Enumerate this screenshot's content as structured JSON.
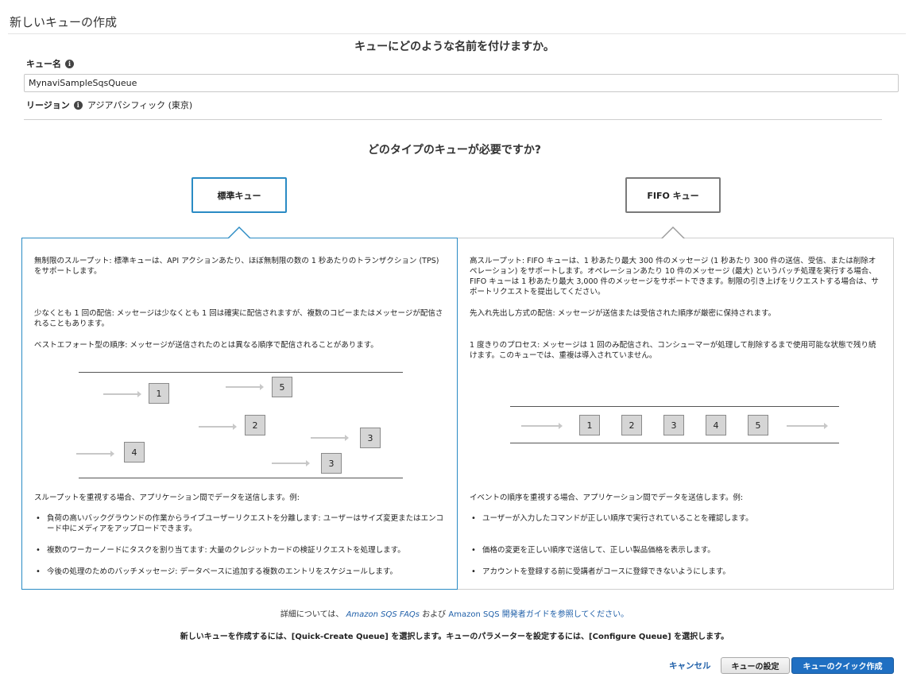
{
  "page": {
    "title": "新しいキューの作成"
  },
  "name_section": {
    "question": "キューにどのような名前を付けますか。",
    "queue_name_label": "キュー名",
    "queue_name_value": "MynaviSampleSqsQueue",
    "region_label": "リージョン",
    "region_value": "アジアパシフィック (東京)"
  },
  "type_section": {
    "question": "どのタイプのキューが必要ですか?",
    "standard_label": "標準キュー",
    "fifo_label": "FIFO キュー"
  },
  "standard_panel": {
    "para1": "無制限のスループット: 標準キューは、API アクションあたり、ほぼ無制限の数の 1 秒あたりのトランザクション (TPS) をサポートします。",
    "para2": "少なくとも 1 回の配信: メッセージは少なくとも 1 回は確実に配信されますが、複数のコピーまたはメッセージが配信されることもあります。",
    "para3": "ベストエフォート型の順序: メッセージが送信されたのとは異なる順序で配信されることがあります。",
    "diagram_numbers": [
      "1",
      "5",
      "2",
      "3",
      "4",
      "3"
    ],
    "use_intro": "スループットを重視する場合、アプリケーション間でデータを送信します。例:",
    "bullets": [
      "負荷の高いバックグラウンドの作業からライブユーザーリクエストを分離します: ユーザーはサイズ変更またはエンコード中にメディアをアップロードできます。",
      "複数のワーカーノードにタスクを割り当てます: 大量のクレジットカードの検証リクエストを処理します。",
      "今後の処理のためのバッチメッセージ: データベースに追加する複数のエントリをスケジュールします。"
    ]
  },
  "fifo_panel": {
    "para1": "高スループット: FIFO キューは、1 秒あたり最大 300 件のメッセージ (1 秒あたり 300 件の送信、受信、または削除オペレーション) をサポートします。オペレーションあたり 10 件のメッセージ (最大) というバッチ処理を実行する場合、FIFO キューは 1 秒あたり最大 3,000 件のメッセージをサポートできます。制限の引き上げをリクエストする場合は、サポートリクエストを提出してください。",
    "para2": "先入れ先出し方式の配信: メッセージが送信または受信された順序が厳密に保持されます。",
    "para3": "1 度きりのプロセス: メッセージは 1 回のみ配信され、コンシューマーが処理して削除するまで使用可能な状態で残り続けます。このキューでは、重複は導入されていません。",
    "diagram_numbers": [
      "1",
      "2",
      "3",
      "4",
      "5"
    ],
    "use_intro": "イベントの順序を重視する場合、アプリケーション間でデータを送信します。例:",
    "bullets": [
      "ユーザーが入力したコマンドが正しい順序で実行されていることを確認します。",
      "価格の変更を正しい順序で送信して、正しい製品価格を表示します。",
      "アカウントを登録する前に受講者がコースに登録できないようにします。"
    ]
  },
  "details": {
    "prefix": "詳細については、",
    "faq_link": "Amazon SQS FAQs",
    "middle": "および",
    "guide_link": "Amazon SQS 開発者ガイドを参照してください。"
  },
  "instruction": "新しいキューを作成するには、[Quick-Create Queue] を選択します。キューのパラメーターを設定するには、[Configure Queue] を選択します。",
  "footer": {
    "cancel": "キャンセル",
    "configure": "キューの設定",
    "quick_create": "キューのクイック作成"
  },
  "colors": {
    "accent": "#2a8bc4",
    "primary_button": "#1f6fc2",
    "link": "#1f5fa8"
  }
}
